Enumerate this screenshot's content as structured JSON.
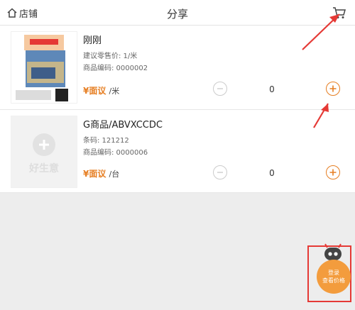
{
  "header": {
    "store_label": "店铺",
    "title": "分享"
  },
  "products": [
    {
      "name": "刚刚",
      "line1": "建议零售价: 1/米",
      "line2": "商品编码: 0000002",
      "price": "¥面议",
      "unit": "/米",
      "qty": "0"
    },
    {
      "name": "G商品/ABVXCCDC",
      "line1": "条码: 121212",
      "line2": "商品编码: 0000006",
      "price": "¥面议",
      "unit": "/台",
      "qty": "0",
      "thumb_text": "好生意"
    }
  ],
  "helper": {
    "line1": "登录",
    "line2": "查看价格"
  },
  "colors": {
    "accent": "#e67e22",
    "annotation": "#e53935"
  }
}
